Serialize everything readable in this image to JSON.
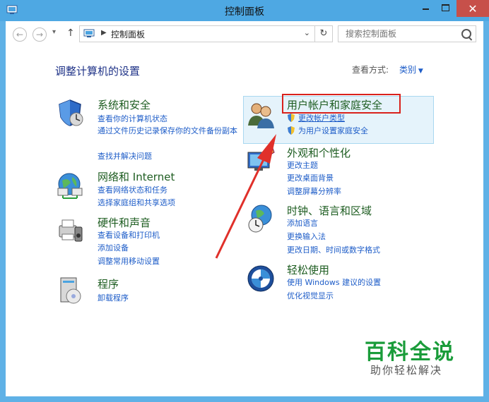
{
  "window": {
    "title": "控制面板"
  },
  "toolbar": {
    "address_text": "控制面板",
    "search_placeholder": "搜索控制面板"
  },
  "header": {
    "heading": "调整计算机的设置",
    "view_label": "查看方式:",
    "view_value": "类别"
  },
  "categories": [
    {
      "title": "系统和安全",
      "links": [
        "查看你的计算机状态",
        "通过文件历史记录保存你的文件备份副本",
        "查找并解决问题"
      ]
    },
    {
      "title": "网络和 Internet",
      "links": [
        "查看网络状态和任务",
        "选择家庭组和共享选项"
      ]
    },
    {
      "title": "硬件和声音",
      "links": [
        "查看设备和打印机",
        "添加设备",
        "调整常用移动设置"
      ]
    },
    {
      "title": "程序",
      "links": [
        "卸载程序"
      ]
    },
    {
      "title": "用户帐户和家庭安全",
      "links": [
        "更改帐户类型",
        "为用户设置家庭安全"
      ]
    },
    {
      "title": "外观和个性化",
      "links": [
        "更改主题",
        "更改桌面背景",
        "调整屏幕分辨率"
      ]
    },
    {
      "title": "时钟、语言和区域",
      "links": [
        "添加语言",
        "更换输入法",
        "更改日期、时间或数字格式"
      ]
    },
    {
      "title": "轻松使用",
      "links": [
        "使用 Windows 建议的设置",
        "优化视觉显示"
      ]
    }
  ],
  "watermark": {
    "title": "百科全说",
    "subtitle": "助你轻松解决"
  }
}
